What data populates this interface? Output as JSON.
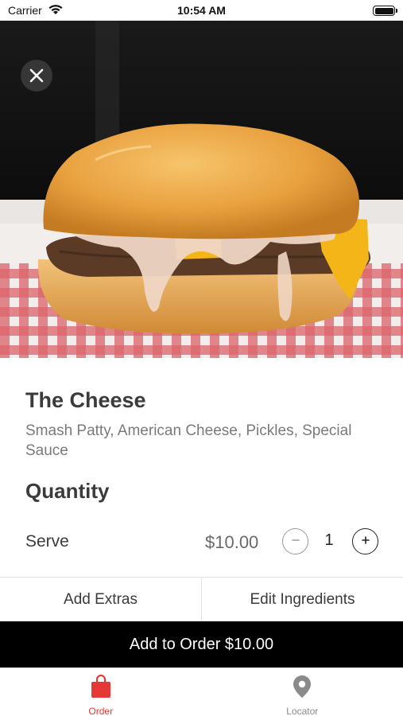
{
  "status_bar": {
    "carrier": "Carrier",
    "time": "10:54 AM"
  },
  "item": {
    "name": "The Cheese",
    "description": "Smash Patty, American Cheese, Pickles, Special Sauce",
    "image_alt": "cheeseburger photo"
  },
  "quantity": {
    "heading": "Quantity",
    "serve_label": "Serve",
    "price": "$10.00",
    "count": "1"
  },
  "options": {
    "add_extras": "Add Extras",
    "edit_ingredients": "Edit Ingredients"
  },
  "add_to_order": {
    "label": "Add to Order $10.00"
  },
  "tabs": [
    {
      "label": "Order",
      "icon": "shopping-bag-icon",
      "active": true
    },
    {
      "label": "Locator",
      "icon": "map-pin-icon",
      "active": false
    }
  ],
  "colors": {
    "accent": "#e53935",
    "button_bg": "#000000",
    "text": "#3b3b3b",
    "muted": "#7a7a7a"
  }
}
